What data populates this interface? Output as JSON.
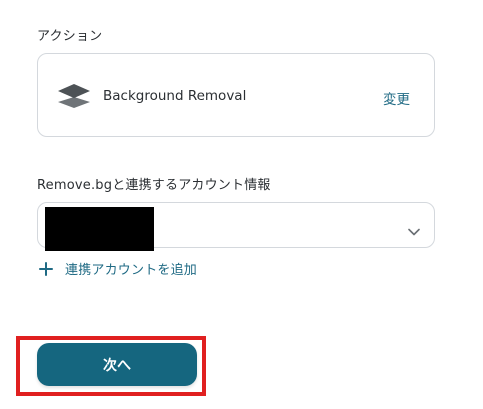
{
  "action_section": {
    "label": "アクション",
    "card": {
      "icon": "layers-icon",
      "action_name": "Background Removal",
      "change_label": "変更"
    }
  },
  "account_section": {
    "label": "Remove.bgと連携するアカウント情報",
    "select": {
      "selected_value": "",
      "redacted": true,
      "chevron_icon": "chevron-down-icon"
    },
    "add_link": {
      "icon": "plus-icon",
      "label": "連携アカウントを追加"
    }
  },
  "footer": {
    "next_button_label": "次へ",
    "highlighted": true
  },
  "colors": {
    "accent": "#15667f",
    "link": "#1f6a84",
    "highlight": "#e02020",
    "border": "#d4d8dd"
  }
}
